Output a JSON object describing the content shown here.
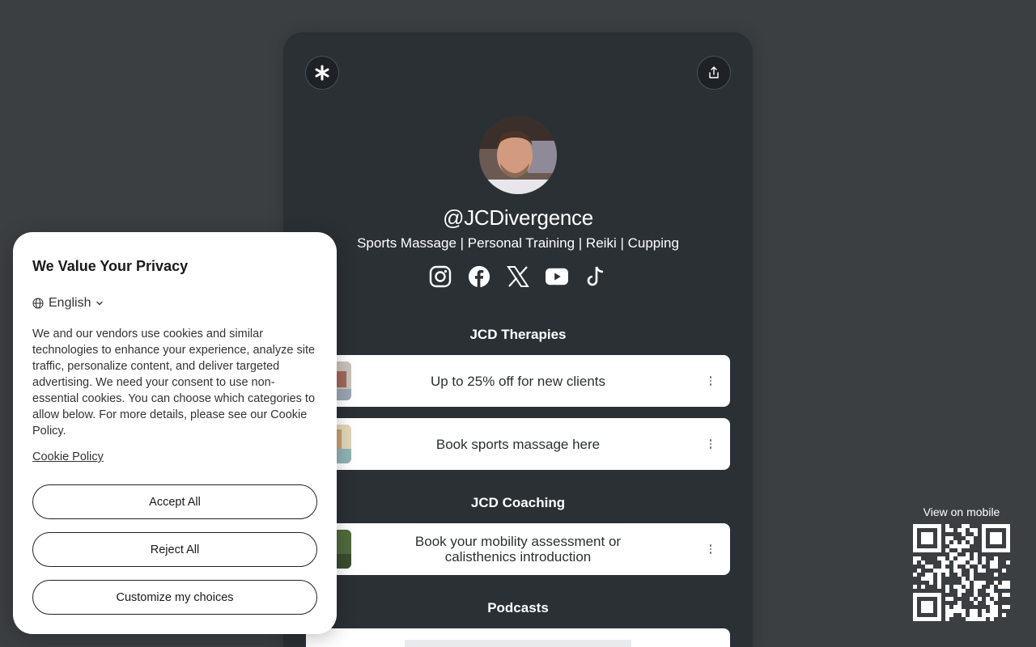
{
  "profile": {
    "username": "@JCDivergence",
    "bio": "Sports Massage | Personal Training | Reiki | Cupping"
  },
  "socials": [
    "instagram-icon",
    "facebook-icon",
    "x-icon",
    "youtube-icon",
    "tiktok-icon"
  ],
  "sections": [
    {
      "title": "JCD Therapies"
    },
    {
      "title": "JCD Coaching"
    },
    {
      "title": "Podcasts"
    }
  ],
  "links": [
    {
      "label": "Up to 25% off for new clients"
    },
    {
      "label": "Book sports massage here"
    },
    {
      "label": "Book your mobility assessment or calisthenics introduction"
    }
  ],
  "privacy": {
    "title": "We Value Your Privacy",
    "language": "English",
    "body": "We and our vendors use cookies and similar technologies to enhance your experience, analyze site traffic, personalize content, and deliver targeted advertising. We need your consent to use non-essential cookies. You can choose which categories to allow below. For more details, please see our Cookie Policy.",
    "policy_link": "Cookie Policy",
    "accept": "Accept All",
    "reject": "Reject All",
    "customize": "Customize my choices"
  },
  "mobile": {
    "label": "View on mobile"
  },
  "colors": {
    "page_bg": "#3b3f42",
    "card_bg": "#2b3035",
    "link_bg": "#ffffff"
  }
}
